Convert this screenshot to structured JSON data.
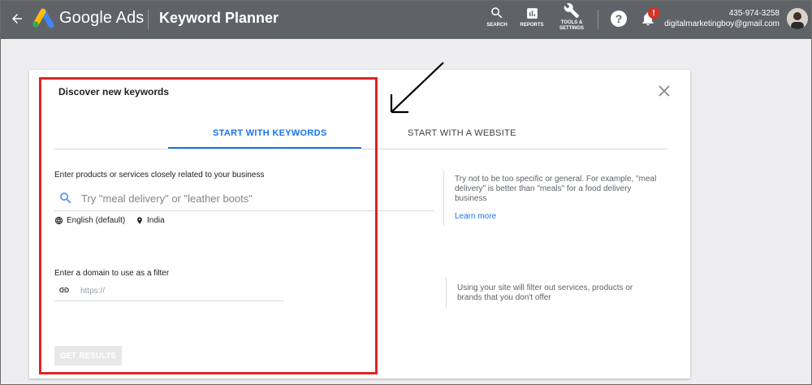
{
  "header": {
    "brand": "Google Ads",
    "page_title": "Keyword Planner",
    "tools": [
      {
        "label": "SEARCH"
      },
      {
        "label": "REPORTS"
      },
      {
        "label_line1": "TOOLS &",
        "label_line2": "SETTINGS"
      }
    ],
    "notification_badge": "!",
    "account_phone": "435-974-3258",
    "account_email": "digitalmarketingboy@gmail.com",
    "colors": {
      "bar": "#5f6368",
      "badge": "#d93025"
    }
  },
  "card": {
    "title": "Discover new keywords",
    "tabs": [
      {
        "label": "START WITH KEYWORDS",
        "active": true
      },
      {
        "label": "START WITH A WEBSITE",
        "active": false
      }
    ],
    "keywords": {
      "label": "Enter products or services closely related to your business",
      "placeholder": "Try \"meal delivery\" or \"leather boots\"",
      "language": "English (default)",
      "location": "India"
    },
    "hint1": {
      "text": "Try not to be too specific or general. For example, \"meal delivery\" is better than \"meals\" for a food delivery business",
      "link": "Learn more"
    },
    "domain": {
      "label": "Enter a domain to use as a filter",
      "placeholder": "https://"
    },
    "hint2": {
      "text": "Using your site will filter out services, products or brands that you don't offer"
    },
    "submit_label": "GET RESULTS",
    "colors": {
      "accent": "#1a73e8",
      "highlight": "#e02424"
    }
  }
}
